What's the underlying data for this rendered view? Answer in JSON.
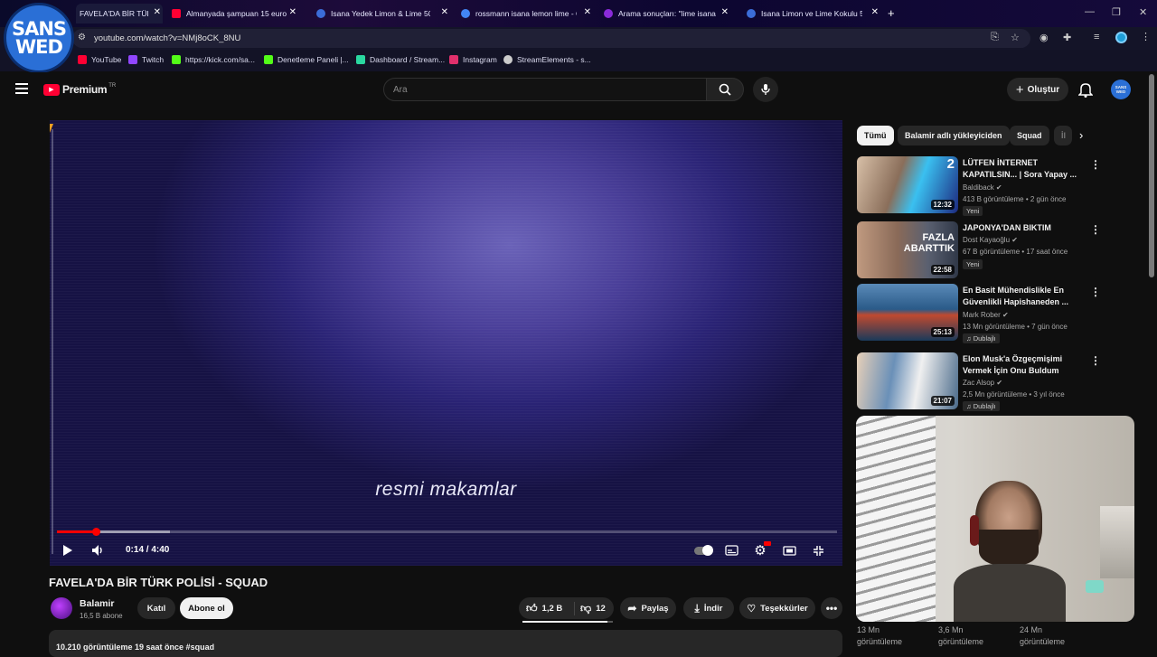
{
  "tabs": [
    {
      "title": "FAVELA'DA BİR TÜRK POLİSİ - S",
      "fav": "#ff0033",
      "active": true
    },
    {
      "title": "Almanyada şampuan 15 euro d",
      "fav": "#ff0033"
    },
    {
      "title": "Isana Yedek Limon & Lime 50",
      "fav": "#3b6dd8"
    },
    {
      "title": "rossmann isana lemon lime - G",
      "fav": "#4285f4"
    },
    {
      "title": "Arama sonuçları: \"lime isana lim",
      "fav": "#8a2bd8"
    },
    {
      "title": "Isana Limon ve Lime Kokulu 50",
      "fav": "#3b6dd8"
    }
  ],
  "address": {
    "url": "youtube.com/watch?v=NMj8oCK_8NU"
  },
  "bookmarks": [
    {
      "label": "YouTube",
      "color": "#ff0033"
    },
    {
      "label": "Twitch",
      "color": "#9146ff"
    },
    {
      "label": "https://kick.com/sa...",
      "color": "#53fc18"
    },
    {
      "label": "Denetleme Paneli |...",
      "color": "#53fc18"
    },
    {
      "label": "Dashboard / Stream...",
      "color": "#2ad7a0"
    },
    {
      "label": "Instagram",
      "color": "#e1306c"
    },
    {
      "label": "StreamElements - s...",
      "color": "#cccccc"
    }
  ],
  "overlay_logo": {
    "line1": "SANS",
    "line2": "WED"
  },
  "header": {
    "logo_text": "Premium",
    "region": "TR",
    "search_placeholder": "Ara",
    "create_label": "Oluştur",
    "avatar_text": "SANS WED"
  },
  "player": {
    "caption": "resmi makamlar",
    "time": "0:14 / 4:40",
    "progress": 0.05,
    "buffered": 0.145
  },
  "video": {
    "title": "FAVELA'DA BİR TÜRK POLİSİ - SQUAD",
    "channel": "Balamir",
    "subscribers": "16,5 B abone",
    "join_label": "Katıl",
    "subscribe_label": "Abone ol",
    "likes": "1,2 B",
    "dislikes": "12",
    "share_label": "Paylaş",
    "download_label": "İndir",
    "thanks_label": "Teşekkürler",
    "description_meta": "10.210 görüntüleme  19 saat önce  #squad"
  },
  "chips": [
    "Tümü",
    "Balamir adlı yükleyiciden",
    "Squad",
    "İl"
  ],
  "recommendations": [
    {
      "title": "LÜTFEN İNTERNET KAPATILSIN... | Sora Yapay ...",
      "channel": "Baldiback",
      "meta": "413 B görüntüleme • 2 gün önce",
      "badge": "Yeni",
      "duration": "12:32",
      "thumb": [
        "#4aa8d8",
        "#2a2e6e"
      ]
    },
    {
      "title": "JAPONYA'DAN BIKTIM",
      "channel": "Dost Kayaoğlu",
      "meta": "67 B görüntüleme • 17 saat önce",
      "badge": "Yeni",
      "duration": "22:58",
      "thumb": [
        "#6a7a90",
        "#2a3240"
      ]
    },
    {
      "title": "En Basit Mühendislikle En Güvenlikli Hapishaneden ...",
      "channel": "Mark Rober",
      "meta": "13 Mn görüntüleme • 7 gün önce",
      "badge": "Dublajlı",
      "duration": "25:13",
      "thumb": [
        "#3a7ab0",
        "#1a3a5a"
      ]
    },
    {
      "title": "Elon Musk'a Özgeçmişimi Vermek İçin Onu Buldum",
      "channel": "Zac Alsop",
      "meta": "2,5 Mn görüntüleme • 3 yıl önce",
      "badge": "Dublajlı",
      "duration": "21:07",
      "thumb": [
        "#8ab0d8",
        "#3a5a7a"
      ]
    }
  ],
  "below_views": [
    {
      "count": "13 Mn",
      "label": "görüntüleme"
    },
    {
      "count": "3,6 Mn",
      "label": "görüntüleme"
    },
    {
      "count": "24 Mn",
      "label": "görüntüleme"
    }
  ]
}
